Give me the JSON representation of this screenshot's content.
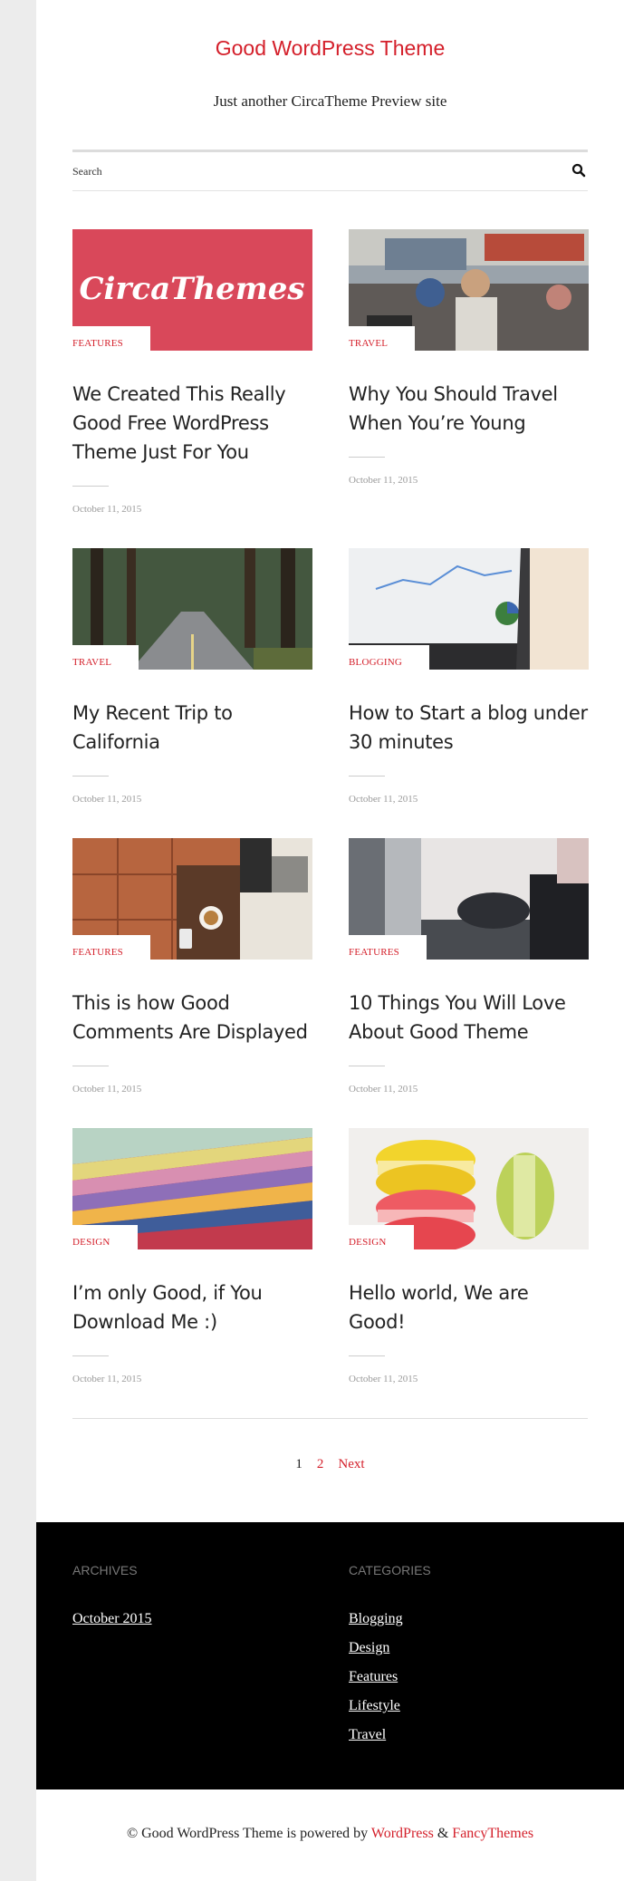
{
  "site": {
    "title": "Good WordPress Theme",
    "description": "Just another CircaTheme Preview site"
  },
  "search": {
    "placeholder": "Search"
  },
  "posts": [
    {
      "category": "FEATURES",
      "title": "We Created This Really Good Free WordPress Theme Just For You",
      "date": "October 11, 2015",
      "thumb_text": "CircaThemes"
    },
    {
      "category": "TRAVEL",
      "title": "Why You Should Travel When You’re Young",
      "date": "October 11, 2015"
    },
    {
      "category": "TRAVEL",
      "title": "My Recent Trip to California",
      "date": "October 11, 2015"
    },
    {
      "category": "BLOGGING",
      "title": "How to Start a blog under 30 minutes",
      "date": "October 11, 2015"
    },
    {
      "category": "FEATURES",
      "title": "This is how Good Comments Are Displayed",
      "date": "October 11, 2015"
    },
    {
      "category": "FEATURES",
      "title": "10 Things You Will Love About Good Theme",
      "date": "October 11, 2015"
    },
    {
      "category": "DESIGN",
      "title": "I’m only Good, if You Download Me :)",
      "date": "October 11, 2015"
    },
    {
      "category": "DESIGN",
      "title": "Hello world, We are Good!",
      "date": "October 11, 2015"
    }
  ],
  "pagination": {
    "current": "1",
    "page2": "2",
    "next": "Next"
  },
  "footer": {
    "archives_title": "ARCHIVES",
    "archives": [
      "October 2015"
    ],
    "categories_title": "CATEGORIES",
    "categories": [
      "Blogging",
      "Design",
      "Features",
      "Lifestyle",
      "Travel"
    ]
  },
  "copyright": {
    "prefix": "© Good WordPress Theme is powered by",
    "wordpress": "WordPress",
    "amp": "&",
    "fancythemes": "FancyThemes"
  },
  "colors": {
    "accent": "#d41f2a",
    "footer_bg": "#000000",
    "sidebar_bg": "#ececec"
  },
  "icons": {
    "search": "search-icon"
  }
}
